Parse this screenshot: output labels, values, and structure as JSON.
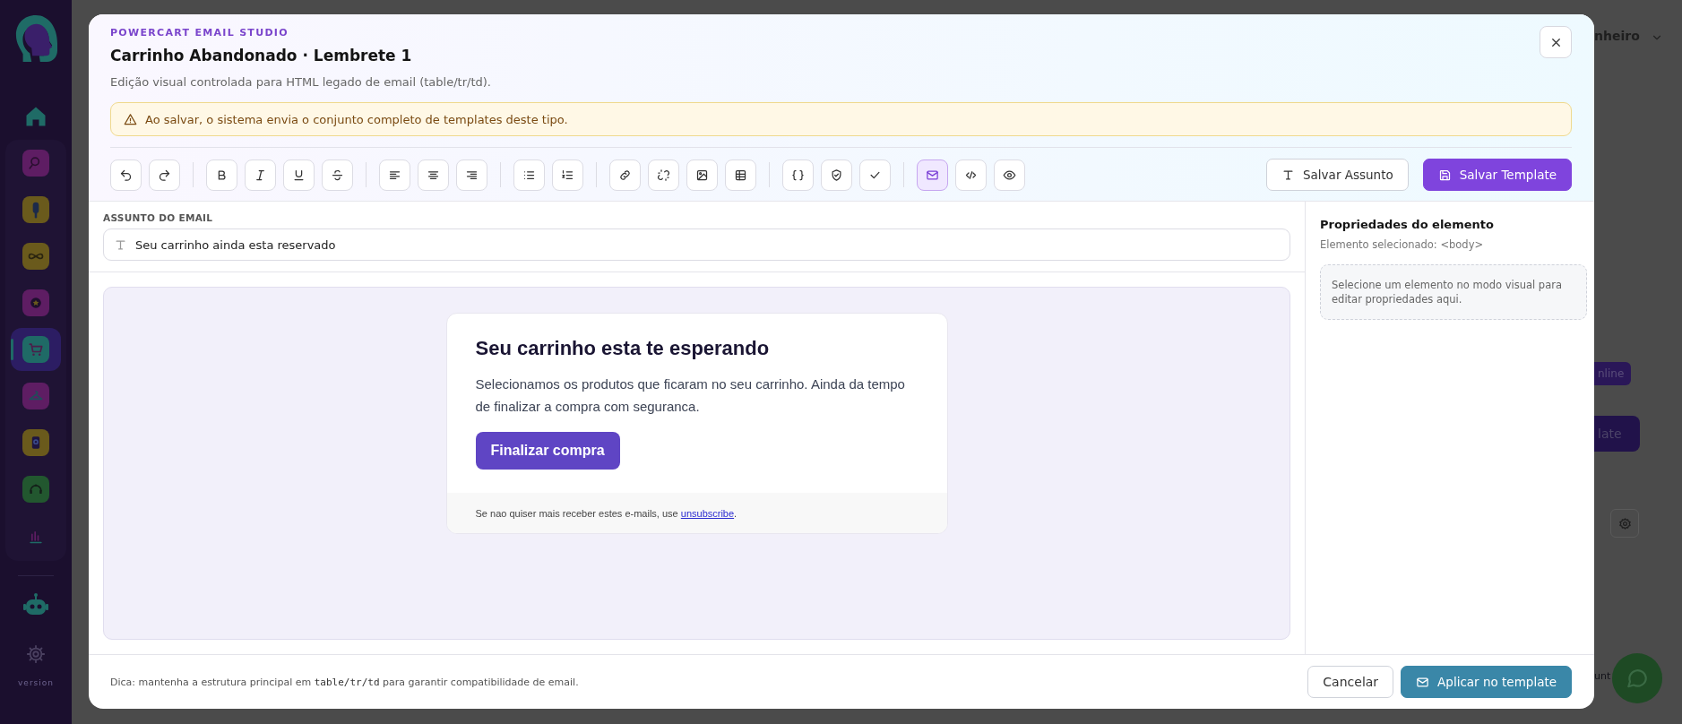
{
  "sidebar": {
    "items": [
      {
        "color": "#5e1d63",
        "selected": false
      },
      {
        "color": "#6a5a1c",
        "selected": false
      },
      {
        "color": "#6a5a1c",
        "selected": false
      },
      {
        "color": "#5e1d63",
        "selected": false
      },
      {
        "color": "#1f6a66",
        "selected": true
      },
      {
        "color": "#5e1d63",
        "selected": false
      },
      {
        "color": "#6a5a1c",
        "selected": false
      },
      {
        "color": "#22572f",
        "selected": false
      },
      {
        "color": "#5e1d63",
        "selected": false
      }
    ],
    "footer_label": "version"
  },
  "background": {
    "user_name": "nheiro",
    "buttons": [
      "nline",
      "late"
    ],
    "footer_text": "unt"
  },
  "modal": {
    "eyebrow": "POWERCART EMAIL STUDIO",
    "title": "Carrinho Abandonado · Lembrete 1",
    "subtitle": "Edição visual controlada para HTML legado de email (table/tr/td).",
    "warning": "Ao salvar, o sistema envia o conjunto completo de templates deste tipo.",
    "toolbar": {
      "groups": [
        [
          {
            "selected": false
          },
          {
            "selected": false
          }
        ],
        [
          {
            "selected": false
          },
          {
            "selected": false
          },
          {
            "selected": false
          },
          {
            "selected": false
          }
        ],
        [
          {
            "selected": false
          },
          {
            "selected": false
          },
          {
            "selected": false
          }
        ],
        [
          {
            "selected": false
          },
          {
            "selected": false
          }
        ],
        [
          {
            "selected": false
          },
          {
            "selected": false
          },
          {
            "selected": false
          },
          {
            "selected": false
          }
        ],
        [
          {
            "selected": false
          },
          {
            "selected": false
          },
          {
            "selected": false
          }
        ],
        [
          {
            "selected": true
          },
          {
            "selected": false
          },
          {
            "selected": false
          }
        ]
      ],
      "actions": [
        "Salvar Assunto",
        "Salvar Template"
      ]
    },
    "subject": {
      "label": "ASSUNTO DO EMAIL",
      "value": "Seu carrinho ainda esta reservado"
    },
    "email": {
      "heading": "Seu carrinho esta te esperando",
      "body": "Selecionamos os produtos que ficaram no seu carrinho. Ainda da tempo de finalizar a compra com seguranca.",
      "button": "Finalizar compra",
      "footer": "Se nao quiser mais receber estes e-mails, use ",
      "footer_link": "unsubscribe",
      "footer_end": "."
    },
    "properties": {
      "title": "Propriedades do elemento",
      "selected_element": "Elemento selecionado: <body>",
      "empty_hint": "Selecione um elemento no modo visual para editar propriedades aqui."
    },
    "footer": {
      "hint_start": "Dica: mantenha a estrutura principal em ",
      "hint_code": "table/tr/td",
      "hint_end": " para garantir compatibilidade de email.",
      "buttons": [
        "Cancelar",
        "Aplicar no template"
      ]
    }
  }
}
